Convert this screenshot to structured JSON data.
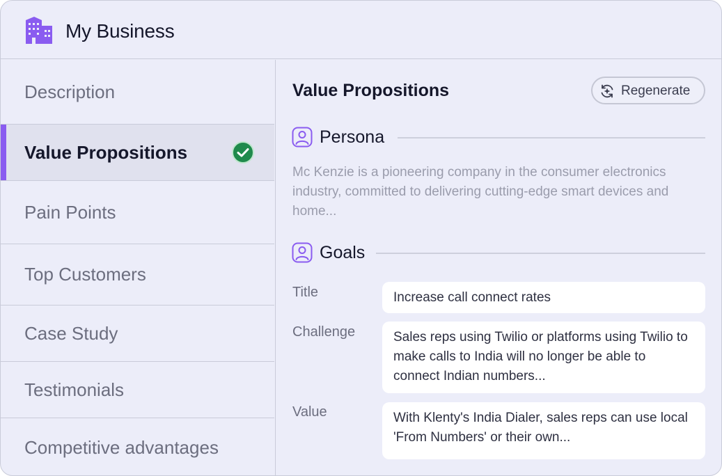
{
  "app": {
    "title": "My Business",
    "logo_icon": "building-icon",
    "accent_color": "#8a5cf0"
  },
  "sidebar": {
    "items": [
      {
        "label": "Description",
        "active": false
      },
      {
        "label": "Value Propositions",
        "active": true,
        "status_icon": "check-circle-icon",
        "status_color": "#1f8a4c"
      },
      {
        "label": "Pain Points",
        "active": false
      },
      {
        "label": "Top Customers",
        "active": false
      },
      {
        "label": "Case Study",
        "active": false
      },
      {
        "label": "Testimonials",
        "active": false
      },
      {
        "label": "Competitive advantages",
        "active": false
      }
    ]
  },
  "main": {
    "title": "Value Propositions",
    "regenerate_label": "Regenerate",
    "regenerate_icon": "sparkle-refresh-icon",
    "persona": {
      "heading": "Persona",
      "icon": "user-icon",
      "text": "Mc Kenzie is a pioneering company in the consumer electronics industry, committed to delivering cutting-edge smart devices and home..."
    },
    "goals": {
      "heading": "Goals",
      "icon": "user-icon",
      "fields": [
        {
          "label": "Title",
          "value": "Increase call connect rates"
        },
        {
          "label": "Challenge",
          "value": "Sales reps using Twilio or platforms using Twilio to make calls to India will no longer be able to connect Indian numbers..."
        },
        {
          "label": "Value",
          "value": "With Klenty's India Dialer, sales reps can use local 'From Numbers' or their own..."
        }
      ]
    }
  }
}
